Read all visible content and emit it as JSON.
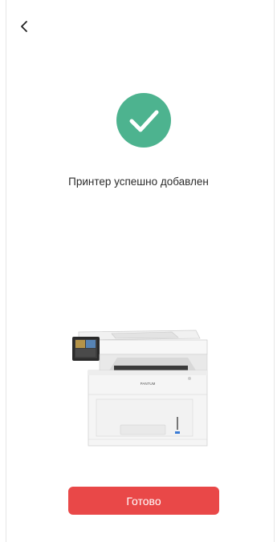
{
  "header": {
    "back_icon": "chevron-left-icon"
  },
  "status": {
    "icon": "check-circle-icon",
    "icon_color": "#4db38f",
    "message": "Принтер успешно добавлен"
  },
  "printer": {
    "brand": "PANTUM"
  },
  "actions": {
    "done_label": "Готово",
    "done_color": "#e94848"
  }
}
